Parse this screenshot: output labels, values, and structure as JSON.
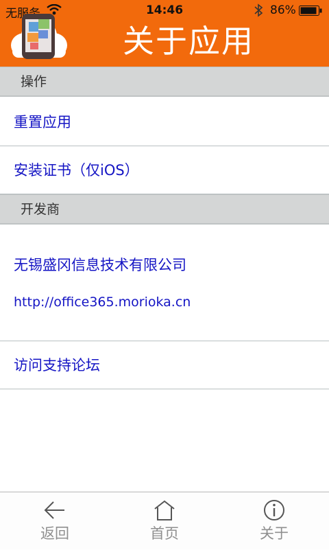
{
  "status_bar": {
    "carrier": "无服务",
    "time": "14:46",
    "battery": "86%"
  },
  "header": {
    "title": "关于应用",
    "color": "#f26a0c"
  },
  "sections": {
    "actions": {
      "label": "操作",
      "items": [
        "重置应用",
        "安装证书（仅iOS）"
      ]
    },
    "developer": {
      "label": "开发商",
      "company": "无锡盛冈信息技术有限公司",
      "url": "http://office365.morioka.cn",
      "forum": "访问支持论坛"
    }
  },
  "tabbar": {
    "items": [
      {
        "label": "返回",
        "icon": "back-arrow-icon"
      },
      {
        "label": "首页",
        "icon": "home-icon"
      },
      {
        "label": "关于",
        "icon": "info-icon"
      }
    ]
  },
  "colors": {
    "link": "#1515c4",
    "section_bg": "#d4d6d6",
    "tab_text": "#8f8f8f"
  }
}
